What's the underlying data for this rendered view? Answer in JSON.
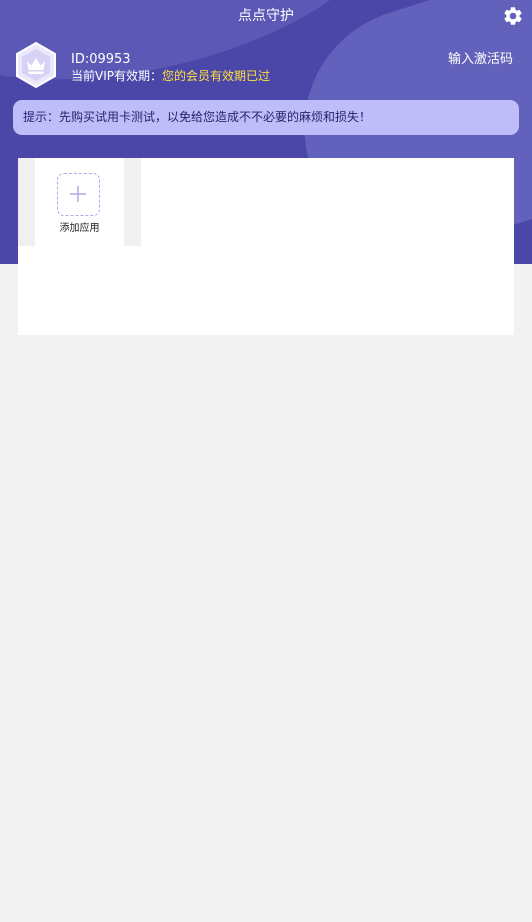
{
  "app": {
    "title": "点点守护"
  },
  "user": {
    "id_text": "ID:09953",
    "vip_label": "当前VIP有效期：",
    "vip_status": "您的会员有效期已过",
    "activate_label": "输入激活码"
  },
  "notice": {
    "text": "提示：先购买试用卡测试，以免给您造成不不必要的麻烦和损失！"
  },
  "apps": {
    "add_label": "添加应用"
  },
  "icons": {
    "settings": "gear-icon",
    "avatar": "crown-hexagon-icon",
    "add": "plus-icon"
  },
  "colors": {
    "header_bg": "#4a47a8",
    "header_blob": "#6b69c2",
    "notice_bg": "#bebcf9",
    "vip_status": "#ffe041",
    "page_bg": "#f2f2f2"
  }
}
